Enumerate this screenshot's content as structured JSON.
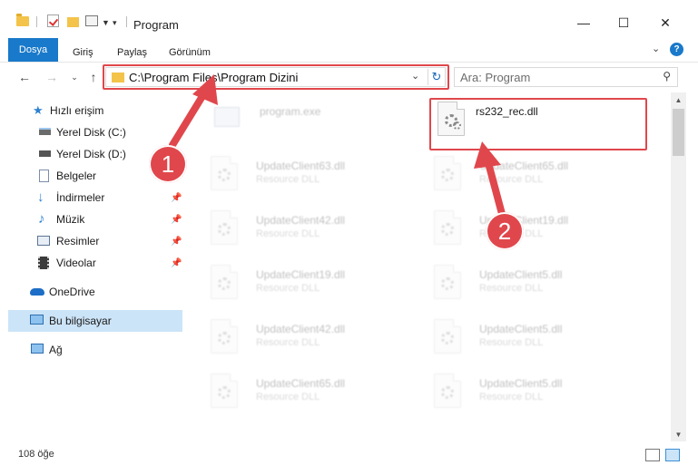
{
  "window": {
    "title": "Program",
    "minimize": "—",
    "maximize": "☐",
    "close": "✕"
  },
  "ribbon": {
    "tabs": [
      "Dosya",
      "Giriş",
      "Paylaş",
      "Görünüm"
    ],
    "help": "?"
  },
  "navigation": {
    "address": "C:\\Program Files\\Program Dizini",
    "search_placeholder": "Ara: Program"
  },
  "sidebar": {
    "items": [
      {
        "label": "Hızlı erişim",
        "icon": "star-icon"
      },
      {
        "label": "Yerel Disk (C:)",
        "icon": "drive-icon"
      },
      {
        "label": "Yerel Disk (D:)",
        "icon": "drive-icon"
      },
      {
        "label": "Belgeler",
        "icon": "documents-icon"
      },
      {
        "label": "İndirmeler",
        "icon": "download-icon"
      },
      {
        "label": "Müzik",
        "icon": "music-icon"
      },
      {
        "label": "Resimler",
        "icon": "pictures-icon"
      },
      {
        "label": "Videolar",
        "icon": "video-icon"
      },
      {
        "label": "OneDrive",
        "icon": "cloud-icon"
      },
      {
        "label": "Bu bilgisayar",
        "icon": "computer-icon"
      },
      {
        "label": "Ağ",
        "icon": "network-icon"
      }
    ]
  },
  "files": [
    {
      "name": "program.exe",
      "type": ""
    },
    {
      "name": "rs232_rec.dll",
      "type": ""
    },
    {
      "name": "UpdateClient63.dll",
      "type": "Resource DLL"
    },
    {
      "name": "UpdateClient65.dll",
      "type": "Resource DLL"
    },
    {
      "name": "UpdateClient42.dll",
      "type": "Resource DLL"
    },
    {
      "name": "UpdateClient19.dll",
      "type": "Resource DLL"
    },
    {
      "name": "UpdateClient19.dll",
      "type": "Resource DLL"
    },
    {
      "name": "UpdateClient5.dll",
      "type": "Resource DLL"
    },
    {
      "name": "UpdateClient42.dll",
      "type": "Resource DLL"
    },
    {
      "name": "UpdateClient5.dll",
      "type": "Resource DLL"
    },
    {
      "name": "UpdateClient65.dll",
      "type": "Resource DLL"
    },
    {
      "name": "UpdateClient5.dll",
      "type": "Resource DLL"
    }
  ],
  "status": {
    "item_count": "108 öğe"
  },
  "callouts": {
    "step1": "1",
    "step2": "2"
  },
  "colors": {
    "accent": "#1979ca",
    "highlight": "#e0474c",
    "selected": "#cce4f7"
  }
}
